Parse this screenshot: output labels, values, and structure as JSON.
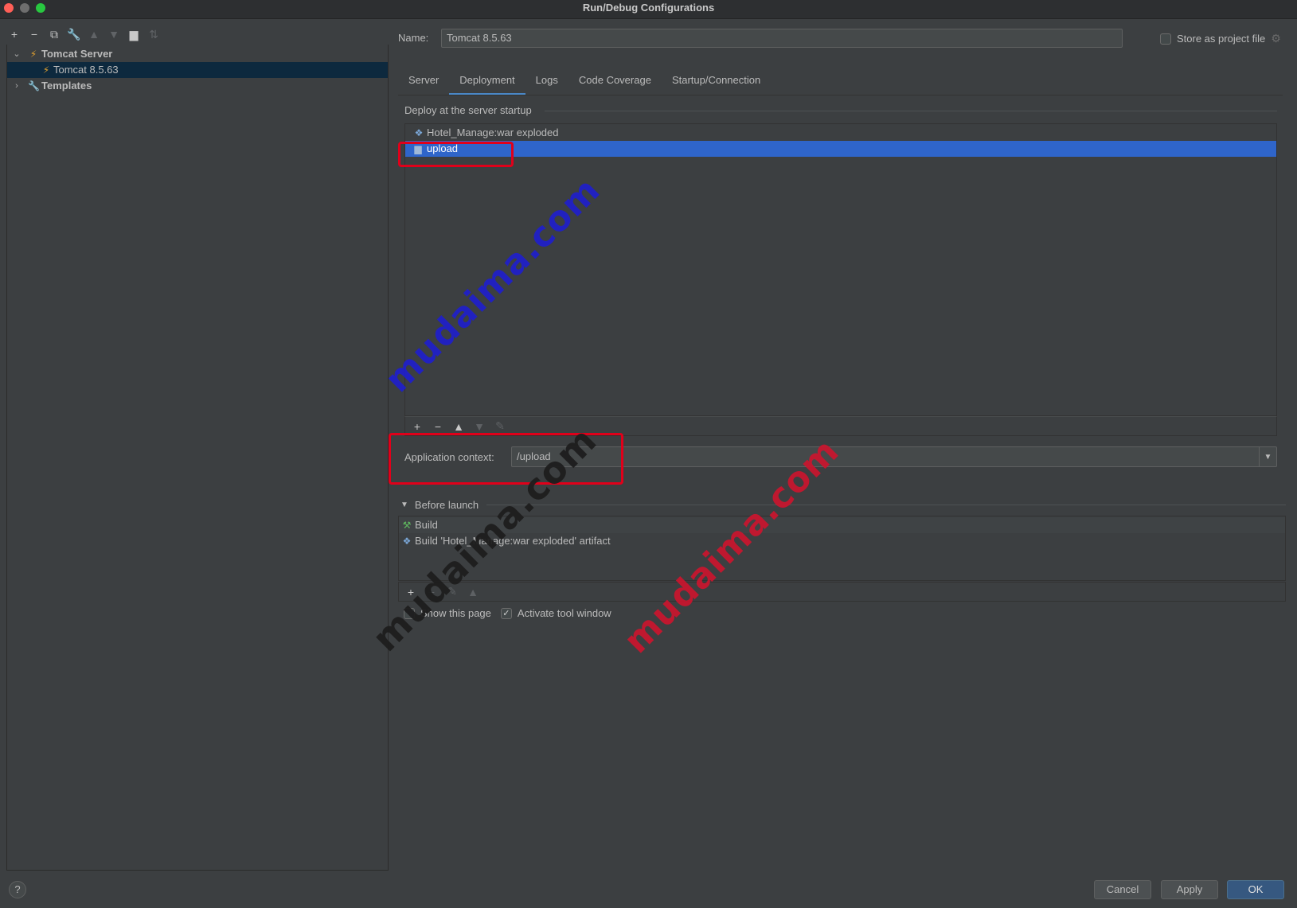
{
  "window": {
    "title": "Run/Debug Configurations"
  },
  "left_toolbar": {
    "icons": [
      "add-icon",
      "remove-icon",
      "copy-icon",
      "wrench-icon",
      "move-up-icon",
      "move-down-icon",
      "folder-icon",
      "sort-icon"
    ]
  },
  "tree": {
    "items": [
      {
        "label": "Tomcat Server",
        "expanded": true,
        "bold": true
      },
      {
        "label": "Tomcat 8.5.63",
        "selected": true
      },
      {
        "label": "Templates",
        "expanded": false,
        "bold": true
      }
    ]
  },
  "config": {
    "name_label": "Name:",
    "name_value": "Tomcat 8.5.63",
    "store_label": "Store as project file"
  },
  "tabs": [
    {
      "label": "Server"
    },
    {
      "label": "Deployment",
      "active": true
    },
    {
      "label": "Logs"
    },
    {
      "label": "Code Coverage"
    },
    {
      "label": "Startup/Connection"
    }
  ],
  "deployment": {
    "section_title": "Deploy at the server startup",
    "items": [
      {
        "label": "Hotel_Manage:war exploded",
        "icon": "artifact-icon"
      },
      {
        "label": "upload",
        "icon": "folder-icon",
        "selected": true
      }
    ],
    "context_label": "Application context:",
    "context_value": "/upload"
  },
  "before_launch": {
    "title": "Before launch",
    "items": [
      {
        "label": "Build",
        "icon": "hammer-icon"
      },
      {
        "label": "Build 'Hotel_Manage:war exploded' artifact",
        "icon": "artifact-icon"
      }
    ],
    "show_page_label": "Show this page",
    "activate_label": "Activate tool window"
  },
  "buttons": {
    "help": "?",
    "cancel": "Cancel",
    "apply": "Apply",
    "ok": "OK"
  },
  "watermarks": [
    "mudaima.com",
    "mudaima.com",
    "mudaima.com"
  ],
  "colors": {
    "selection": "#2f65ca",
    "accent": "#4a88c7",
    "annotation": "#e0001a"
  }
}
